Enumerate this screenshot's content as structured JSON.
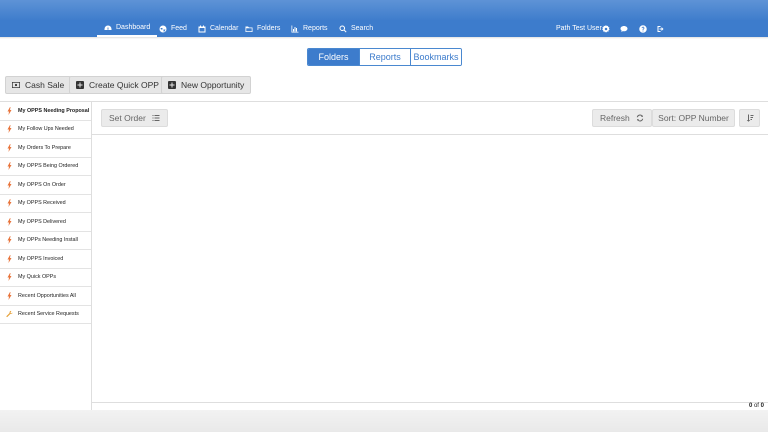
{
  "nav": {
    "items": [
      {
        "label": "Dashboard",
        "icon": "dashboard-icon"
      },
      {
        "label": "Feed",
        "icon": "globe-icon"
      },
      {
        "label": "Calendar",
        "icon": "calendar-icon"
      },
      {
        "label": "Folders",
        "icon": "folder-icon"
      },
      {
        "label": "Reports",
        "icon": "bar-chart-icon"
      },
      {
        "label": "Search",
        "icon": "search-icon"
      }
    ],
    "user": "Path Test User",
    "right_icons": [
      "gear-icon",
      "chat-icon",
      "help-icon",
      "logout-icon"
    ]
  },
  "view_tabs": {
    "folders": "Folders",
    "reports": "Reports",
    "bookmarks": "Bookmarks"
  },
  "actions": {
    "cash_sale": "Cash Sale",
    "create_quick_opp": "Create Quick OPP",
    "new_opportunity": "New Opportunity"
  },
  "sidebar": {
    "items": [
      {
        "label": "My OPPS Needing Proposal",
        "icon": "bolt-icon"
      },
      {
        "label": "My Follow Ups Needed",
        "icon": "bolt-icon"
      },
      {
        "label": "My Orders To Prepare",
        "icon": "bolt-icon"
      },
      {
        "label": "My OPPS Being Ordered",
        "icon": "bolt-icon"
      },
      {
        "label": "My OPPS On Order",
        "icon": "bolt-icon"
      },
      {
        "label": "My OPPS Received",
        "icon": "bolt-icon"
      },
      {
        "label": "My OPPS Delivered",
        "icon": "bolt-icon"
      },
      {
        "label": "My OPPs Needing Install",
        "icon": "bolt-icon"
      },
      {
        "label": "My OPPS Invoiced",
        "icon": "bolt-icon"
      },
      {
        "label": "My Quick OPPs",
        "icon": "bolt-icon"
      },
      {
        "label": "Recent Opportunities All",
        "icon": "bolt-icon"
      },
      {
        "label": "Recent Service Requests",
        "icon": "wrench-icon"
      }
    ]
  },
  "toolbar": {
    "set_order": "Set Order",
    "refresh": "Refresh",
    "sort": "Sort: OPP Number"
  },
  "pagination": {
    "current": "0",
    "of": "of",
    "total": "0"
  },
  "colors": {
    "nav_blue": "#3d7ccc",
    "bolt_orange": "#e8743b",
    "wrench_yellow": "#e6a23c"
  }
}
